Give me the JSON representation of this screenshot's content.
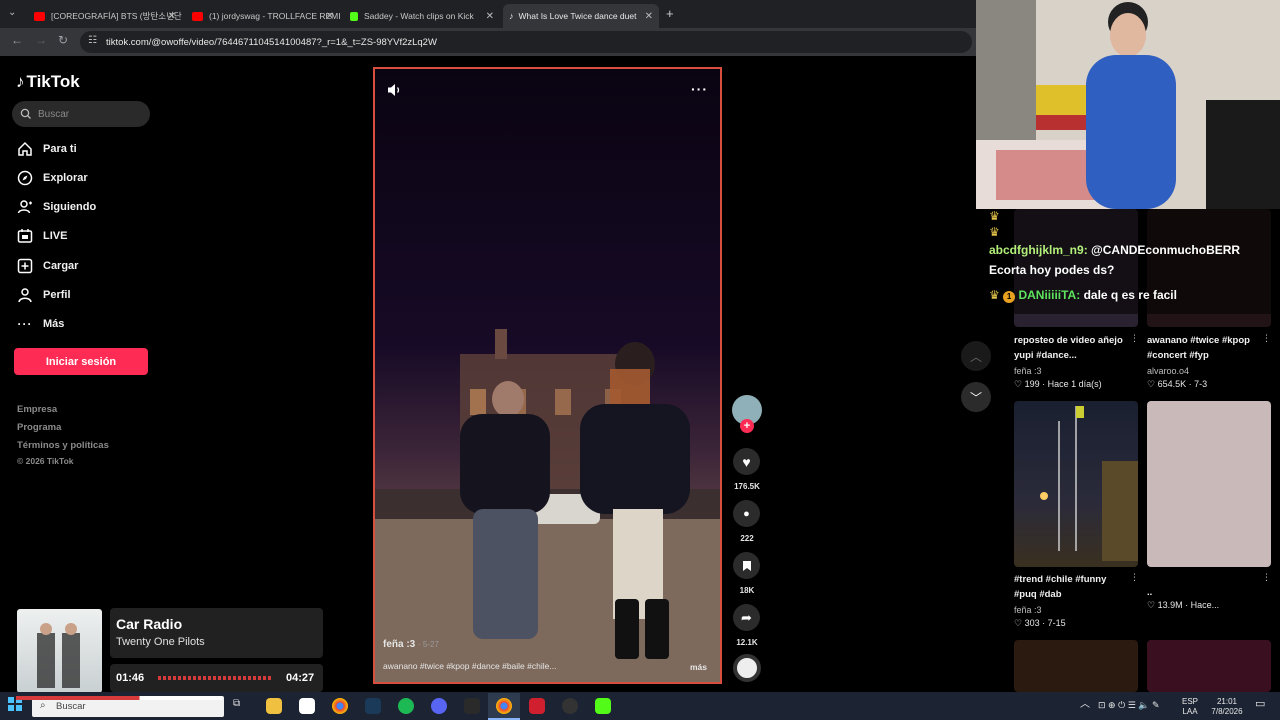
{
  "browser": {
    "tabs": [
      {
        "label": "[COREOGRAFÍA] BTS (방탄소년단",
        "color": "#ff0000"
      },
      {
        "label": "(1) jordyswag - TROLLFACE REMI",
        "color": "#ff0000"
      },
      {
        "label": "Saddey - Watch clips on Kick",
        "color": "#53fc18"
      },
      {
        "label": "What Is Love Twice dance duet",
        "color": "#ffffff"
      }
    ],
    "url": "tiktok.com/@owoffe/video/7644671104514100487?_r=1&_t=ZS-98YVf2zLq2W"
  },
  "sidebar": {
    "logo": "TikTok",
    "search_placeholder": "Buscar",
    "nav": [
      {
        "label": "Para ti",
        "icon": "home-icon"
      },
      {
        "label": "Explorar",
        "icon": "compass-icon"
      },
      {
        "label": "Siguiendo",
        "icon": "following-icon"
      },
      {
        "label": "LIVE",
        "icon": "live-icon"
      },
      {
        "label": "Cargar",
        "icon": "upload-icon"
      },
      {
        "label": "Perfil",
        "icon": "profile-icon"
      },
      {
        "label": "Más",
        "icon": "more-icon"
      }
    ],
    "login_label": "Iniciar sesión",
    "footer": [
      "Empresa",
      "Programa",
      "Términos y políticas",
      "© 2026 TikTok"
    ]
  },
  "video": {
    "author": "feña :3",
    "date": "5-27",
    "caption": "awanano #twice #kpop #dance #baile #chile...",
    "more_label": "más"
  },
  "actions": {
    "likes": "176.5K",
    "comments": "222",
    "saves": "18K",
    "shares": "12.1K"
  },
  "recommended": [
    {
      "title": "reposteo de video añejo yupi #dance...",
      "user": "feña :3",
      "likes": "199",
      "time": "Hace 1 día(s)"
    },
    {
      "title": "awanano #twice #kpop #concert #fyp",
      "user": "alvaroo.o4",
      "likes": "654.5K",
      "time": "7-3"
    },
    {
      "title": "#trend #chile #funny #puq #dab",
      "user": "feña :3",
      "likes": "303",
      "time": "7-15"
    },
    {
      "title": "..",
      "user": "",
      "likes": "13.9M",
      "time": "Hace..."
    }
  ],
  "chat": {
    "line1_user": "abcdfghijklm_n9:",
    "line1_text": "@CANDEconmuchoBERR",
    "line1_cont": "Ecorta hoy podes ds?",
    "line2_user": "DANiiiiiTA:",
    "line2_text": "dale q es re facil",
    "user1_color": "#b3f07a",
    "user2_color": "#5ee35e"
  },
  "music": {
    "title": "Car Radio",
    "artist": "Twenty One Pilots",
    "elapsed": "01:46",
    "duration": "04:27"
  },
  "taskbar": {
    "search_placeholder": "Buscar",
    "lang": "ESP",
    "lang2": "LAA",
    "time": "21:01",
    "date": "7/8/2026"
  }
}
